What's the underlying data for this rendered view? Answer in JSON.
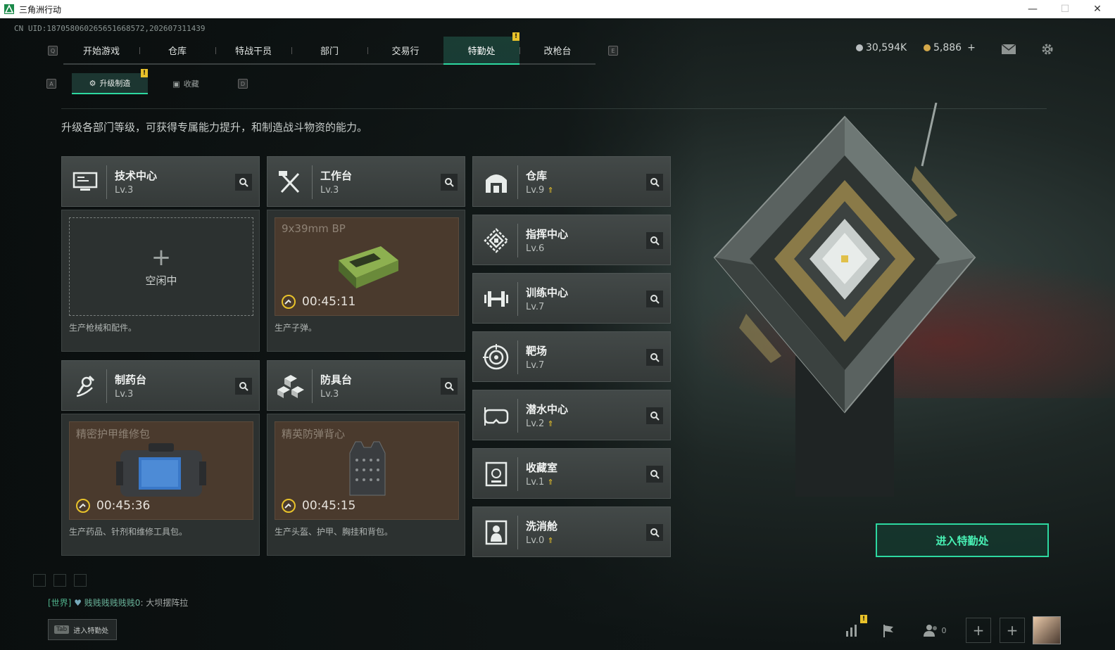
{
  "window": {
    "title": "三角洲行动",
    "minimize": "—",
    "maximize": "☐",
    "close": "✕"
  },
  "uid": "CN UID:187058060265651668572,202607311439",
  "topnav": {
    "left_key": "Q",
    "right_key": "E",
    "tabs": [
      "开始游戏",
      "仓库",
      "特战干员",
      "部门",
      "交易行",
      "特勤处",
      "改枪台"
    ],
    "active": "特勤处",
    "badge": "!"
  },
  "subnav": {
    "left_key": "A",
    "right_key": "D",
    "tabs": [
      "升级制造",
      "收藏"
    ],
    "active": "升级制造",
    "badge": "!"
  },
  "currency": {
    "silver": "30,594K",
    "gold": "5,886",
    "add": "+"
  },
  "description": "升级各部门等级，可获得专属能力提升，和制造战斗物资的能力。",
  "production": [
    {
      "name": "技术中心",
      "level": "Lv.3",
      "icon": "monitor-icon",
      "idle": true,
      "idle_label": "空闲中",
      "desc": "生产枪械和配件。"
    },
    {
      "name": "工作台",
      "level": "Lv.3",
      "icon": "tools-icon",
      "item": "9x39mm BP",
      "timer": "00:45:11",
      "desc": "生产子弹。"
    },
    {
      "name": "制药台",
      "level": "Lv.3",
      "icon": "microscope-icon",
      "item": "精密护甲维修包",
      "timer": "00:45:36",
      "desc": "生产药品、针剂和维修工具包。"
    },
    {
      "name": "防具台",
      "level": "Lv.3",
      "icon": "cubes-icon",
      "item": "精英防弹背心",
      "timer": "00:45:15",
      "desc": "生产头盔、护甲、胸挂和背包。"
    }
  ],
  "departments": [
    {
      "name": "仓库",
      "level": "Lv.9",
      "upgrade": true,
      "icon": "warehouse-icon"
    },
    {
      "name": "指挥中心",
      "level": "Lv.6",
      "upgrade": false,
      "icon": "command-icon"
    },
    {
      "name": "训练中心",
      "level": "Lv.7",
      "upgrade": false,
      "icon": "dumbbell-icon"
    },
    {
      "name": "靶场",
      "level": "Lv.7",
      "upgrade": false,
      "icon": "target-icon"
    },
    {
      "name": "潜水中心",
      "level": "Lv.2",
      "upgrade": true,
      "icon": "diving-mask-icon"
    },
    {
      "name": "收藏室",
      "level": "Lv.1",
      "upgrade": true,
      "icon": "collection-icon"
    },
    {
      "name": "洗消舱",
      "level": "Lv.0",
      "upgrade": true,
      "icon": "decon-icon"
    }
  ],
  "enter_button": "进入特勤处",
  "chat": {
    "channel": "[世界]",
    "user": "贱贱贱贱贱贱0",
    "message": "大坝摆阵拉"
  },
  "tab_hint": {
    "key": "Tab",
    "label": "进入特勤处"
  },
  "friends_count": "0",
  "colors": {
    "accent": "#2dd8a0",
    "badge": "#e8c22a",
    "production_bg": "#4a3a2d"
  }
}
